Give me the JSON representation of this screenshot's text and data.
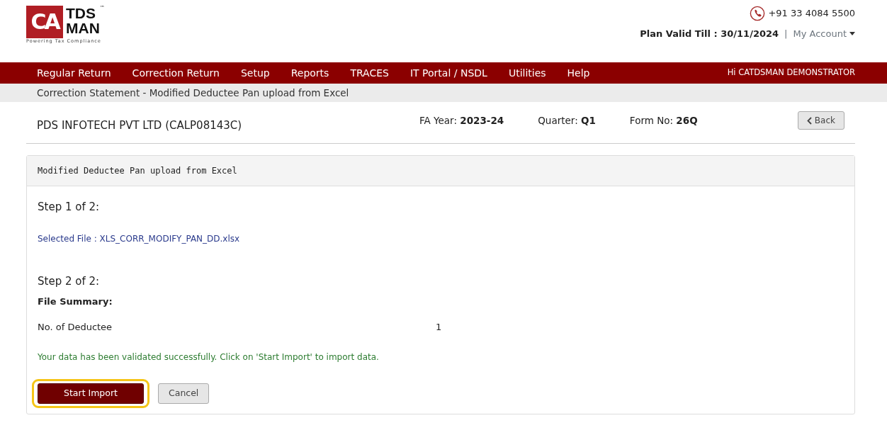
{
  "logo": {
    "mark": "CA",
    "word_top": "TDS",
    "word_bottom": "MAN",
    "trademark": "™",
    "tagline": "Powering Tax Compliance"
  },
  "header": {
    "phone": "+91 33 4084 5500",
    "plan_valid": "Plan Valid Till : 30/11/2024",
    "separator": "|",
    "account": "My Account"
  },
  "nav": {
    "items": [
      "Regular Return",
      "Correction Return",
      "Setup",
      "Reports",
      "TRACES",
      "IT Portal / NSDL",
      "Utilities",
      "Help"
    ],
    "greeting": "Hi CATDSMAN DEMONSTRATOR"
  },
  "breadcrumb": "Correction Statement - Modified Deductee Pan upload from Excel",
  "info": {
    "company": "PDS INFOTECH PVT LTD (CALP08143C)",
    "fields": [
      {
        "label": "FA Year:",
        "value": "2023-24"
      },
      {
        "label": "Quarter:",
        "value": "Q1"
      },
      {
        "label": "Form No:",
        "value": "26Q"
      }
    ],
    "back_button": "Back"
  },
  "panel": {
    "title": "Modified Deductee Pan upload from Excel",
    "step1": {
      "heading": "Step 1 of 2:",
      "selected_file": "Selected File : XLS_CORR_MODIFY_PAN_DD.xlsx"
    },
    "step2": {
      "heading": "Step 2 of 2:",
      "summary_label": "File Summary:",
      "rows": [
        {
          "label": "No. of Deductee",
          "value": "1"
        }
      ],
      "message": "Your data has been validated successfully. Click on 'Start Import' to import data."
    },
    "buttons": [
      {
        "label": "Start Import",
        "kind": "primary",
        "highlighted": true
      },
      {
        "label": "Cancel",
        "kind": "secondary",
        "highlighted": false
      }
    ]
  }
}
